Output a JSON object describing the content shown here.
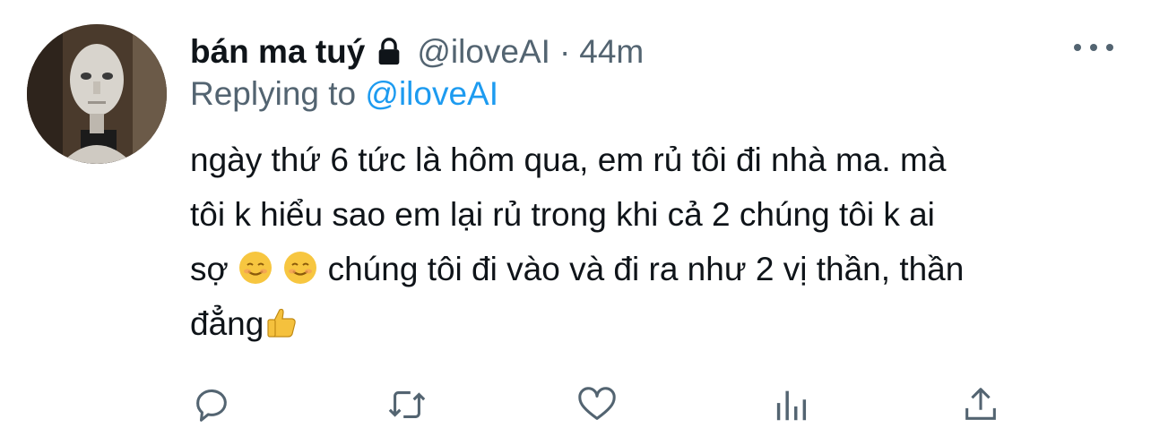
{
  "tweet": {
    "author_name": "bán ma tuý",
    "handle": "@iloveAI",
    "separator": "·",
    "time": "44m",
    "replying_prefix": "Replying to",
    "replying_to": "@iloveAI",
    "lines": [
      "ngày thứ 6 tức là hôm qua, em rủ tôi đi nhà ma. mà",
      "tôi k hiểu sao em lại rủ trong khi cả 2 chúng tôi k ai",
      "chúng tôi đi vào và đi ra như 2 vị thần, thần",
      "đẳng"
    ],
    "line3_prefix": "sợ"
  },
  "icons": {
    "lock": "lock-icon",
    "more": "more-icon",
    "reply": "reply-icon",
    "retweet": "retweet-icon",
    "like": "heart-icon",
    "analytics": "analytics-icon",
    "share": "share-icon",
    "emoji_smile": "smiling-face-emoji",
    "emoji_thumbs": "thumbs-up-emoji"
  },
  "colors": {
    "text": "#0f1419",
    "secondary": "#536471",
    "link": "#1d9bf0"
  }
}
